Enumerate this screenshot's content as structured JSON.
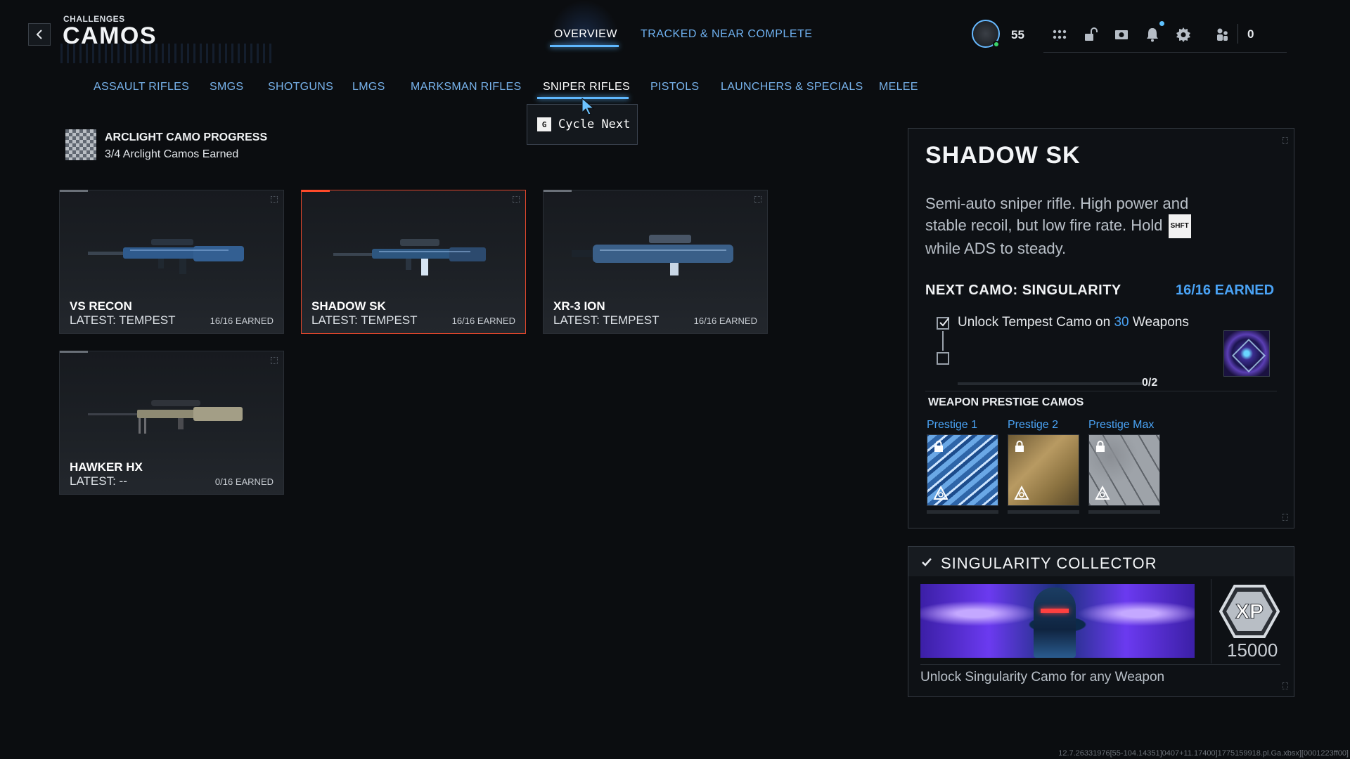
{
  "header": {
    "breadcrumb": "CHALLENGES",
    "title": "CAMOS",
    "tabs": [
      {
        "label": "OVERVIEW",
        "active": true
      },
      {
        "label": "TRACKED & NEAR COMPLETE",
        "active": false
      }
    ],
    "player_level": "55",
    "currency_value": "0",
    "icons": [
      "avatar",
      "grid-menu-icon",
      "unlock-icon",
      "store-icon",
      "bell-icon",
      "gear-icon",
      "friends-icon"
    ]
  },
  "categories": [
    {
      "label": "ASSAULT RIFLES",
      "active": false
    },
    {
      "label": "SMGS",
      "active": false
    },
    {
      "label": "SHOTGUNS",
      "active": false
    },
    {
      "label": "LMGS",
      "active": false
    },
    {
      "label": "MARKSMAN RIFLES",
      "active": false
    },
    {
      "label": "SNIPER RIFLES",
      "active": true
    },
    {
      "label": "PISTOLS",
      "active": false
    },
    {
      "label": "LAUNCHERS & SPECIALS",
      "active": false
    },
    {
      "label": "MELEE",
      "active": false
    }
  ],
  "tooltip": {
    "key": "G",
    "label": "Cycle Next"
  },
  "arclight": {
    "title": "ARCLIGHT CAMO PROGRESS",
    "subtitle": "3/4 Arclight Camos Earned"
  },
  "weapons": [
    {
      "name": "VS RECON",
      "latest": "LATEST: TEMPEST",
      "earned": "16/16 EARNED",
      "selected": false
    },
    {
      "name": "SHADOW SK",
      "latest": "LATEST: TEMPEST",
      "earned": "16/16 EARNED",
      "selected": true
    },
    {
      "name": "XR-3 ION",
      "latest": "LATEST: TEMPEST",
      "earned": "16/16 EARNED",
      "selected": false
    },
    {
      "name": "HAWKER HX",
      "latest": "LATEST: --",
      "earned": "0/16 EARNED",
      "selected": false
    }
  ],
  "detail": {
    "title": "SHADOW SK",
    "desc_before": "Semi-auto sniper rifle. High power and stable recoil, but low fire rate. Hold",
    "desc_key": "SHFT",
    "desc_after": "while ADS to steady.",
    "next_camo_label": "NEXT CAMO: SINGULARITY",
    "next_camo_earned": "16/16 EARNED",
    "requirement_prefix": "Unlock Tempest Camo on",
    "requirement_count": "30",
    "requirement_suffix": "Weapons",
    "requirement_done": true,
    "progress": "0/2",
    "progress_fraction": 0,
    "prestige_title": "WEAPON PRESTIGE CAMOS",
    "prestige": [
      {
        "label": "Prestige 1",
        "locked": true
      },
      {
        "label": "Prestige 2",
        "locked": true
      },
      {
        "label": "Prestige Max",
        "locked": true
      }
    ]
  },
  "collector": {
    "title": "SINGULARITY COLLECTOR",
    "xp_label": "XP",
    "xp_value": "15000",
    "description": "Unlock Singularity Camo for any Weapon"
  },
  "footer": {
    "version": "12.7.26331976[55-104.14351]0407+11.17400]1775159918.pl.Ga.xbsx][0001223ff00]"
  },
  "colors": {
    "accent_blue": "#4aa3f5",
    "selected_border": "#e0472c",
    "background": "#0b0d10"
  }
}
